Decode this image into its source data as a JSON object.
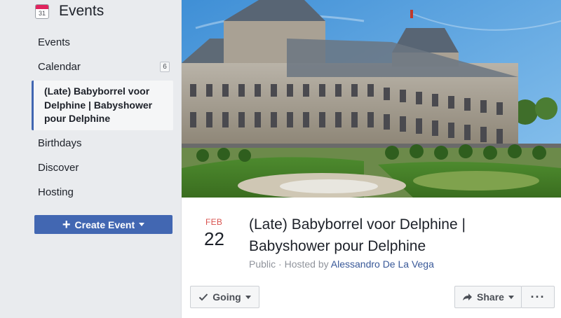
{
  "sidebar": {
    "title": "Events",
    "calendar_icon_day": "31",
    "items": [
      {
        "label": "Events"
      },
      {
        "label": "Calendar",
        "badge": "6"
      },
      {
        "label": "(Late) Babyborrel voor Delphine | Babyshower pour Delphine",
        "active": true
      },
      {
        "label": "Birthdays"
      },
      {
        "label": "Discover"
      },
      {
        "label": "Hosting"
      }
    ],
    "create_button": {
      "label": "Create Event",
      "icon": "plus-icon"
    }
  },
  "event": {
    "month": "FEB",
    "day": "22",
    "title_line1": "(Late) Babyborrel voor Delphine |",
    "title_line2": "Babyshower pour Delphine",
    "privacy": "Public",
    "separator": "·",
    "hosted_by": "Hosted by",
    "host": "Alessandro De La Vega"
  },
  "actions": {
    "going": "Going",
    "share": "Share",
    "more": "···"
  },
  "colors": {
    "accent": "#4267b2",
    "link": "#385898",
    "date_month": "#d9534f",
    "sidebar_bg": "#e9ebee"
  }
}
